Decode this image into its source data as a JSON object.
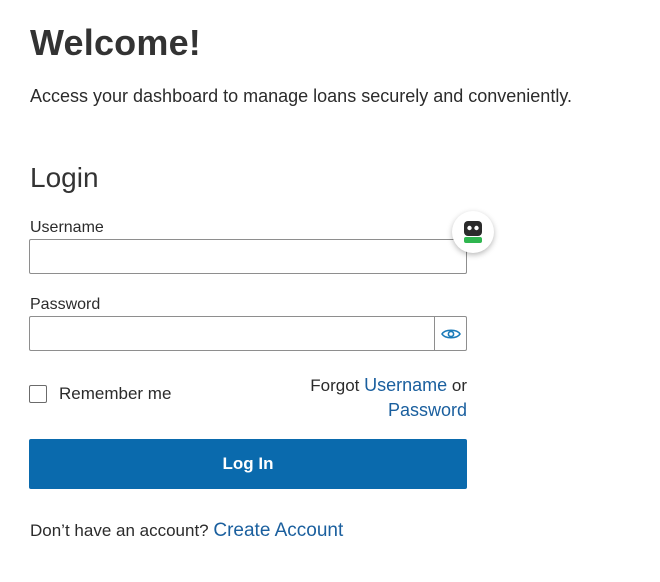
{
  "header": {
    "title": "Welcome!",
    "subtitle": "Access your dashboard to manage loans securely and conveniently."
  },
  "login": {
    "section_title": "Login",
    "username_label": "Username",
    "username_value": "",
    "password_label": "Password",
    "password_value": "",
    "remember_label": "Remember me",
    "remember_checked": false,
    "forgot_prefix": "Forgot",
    "forgot_username_link": "Username",
    "forgot_or": "or",
    "forgot_password_link": "Password",
    "submit_label": "Log In"
  },
  "signup": {
    "prompt": "Don’t have an account?",
    "link": "Create Account"
  },
  "icons": {
    "password_toggle": "eye-icon",
    "assistant": "robot-icon"
  },
  "colors": {
    "primary": "#0a6aad",
    "link": "#1a5f9e",
    "eye_icon": "#1a7ab8",
    "assistant_accent": "#2fb64f"
  }
}
